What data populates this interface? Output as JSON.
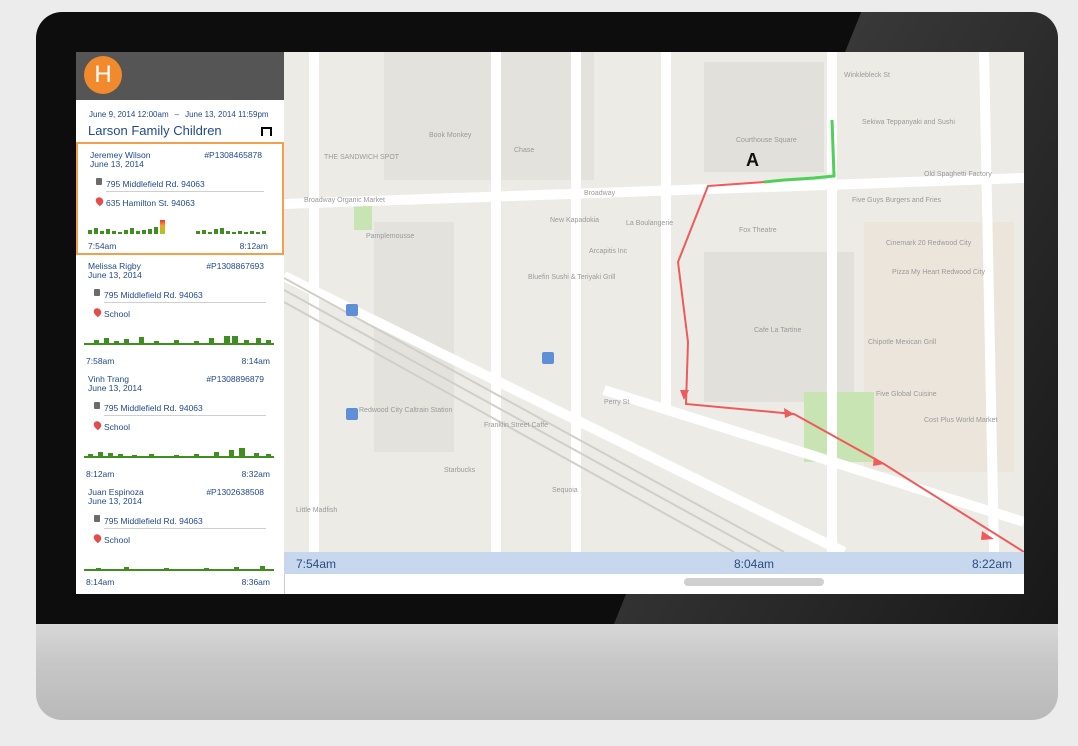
{
  "sidebar": {
    "logo": "H",
    "range_start": "June 9, 2014 12:00am",
    "range_sep": "–",
    "range_end": "June 13, 2014 11:59pm",
    "group": "Larson Family Children",
    "trips": [
      {
        "name": "Jeremey Wilson",
        "id": "#P1308465878",
        "date": "June 13, 2014",
        "from": "795 Middlefield Rd. 94063",
        "to": "635 Hamilton St. 94063",
        "start": "7:54am",
        "end": "8:12am"
      },
      {
        "name": "Melissa Rigby",
        "id": "#P1308867693",
        "date": "June 13, 2014",
        "from": "795 Middlefield Rd. 94063",
        "to": "School",
        "start": "7:58am",
        "end": "8:14am"
      },
      {
        "name": "Vinh Trang",
        "id": "#P1308896879",
        "date": "June 13, 2014",
        "from": "795 Middlefield Rd. 94063",
        "to": "School",
        "start": "8:12am",
        "end": "8:32am"
      },
      {
        "name": "Juan Espinoza",
        "id": "#P1302638508",
        "date": "June 13, 2014",
        "from": "795 Middlefield Rd. 94063",
        "to": "School",
        "start": "8:14am",
        "end": "8:36am"
      }
    ]
  },
  "map": {
    "marker": "A",
    "labels": [
      "THE SANDWICH SPOT",
      "Broadway Organic Market",
      "Book Monkey",
      "Chase",
      "Pamplemousse",
      "New Kapadokia",
      "La Boulangerie",
      "Fox Theatre",
      "Arcapitis Inc",
      "Bluefin Sushi & Teriyaki Grill",
      "Courthouse Square",
      "Sekiwa Teppanyaki and Sushi",
      "Five Guys Burgers and Fries",
      "Old Spaghetti Factory",
      "Cinemark 20 Redwood City",
      "Pizza My Heart Redwood City",
      "Cafe La Tartine",
      "Chipotle Mexican Grill",
      "Five Global Cuisine",
      "Cost Plus World Market",
      "Redwood City Caltrain Station",
      "Franklin Street Caffe",
      "Starbucks",
      "Sequoia",
      "Little Madfish",
      "Broadway",
      "Perry St",
      "Winklebleck St"
    ]
  },
  "timeline": {
    "start": "7:54am",
    "mid": "8:04am",
    "end": "8:22am"
  }
}
